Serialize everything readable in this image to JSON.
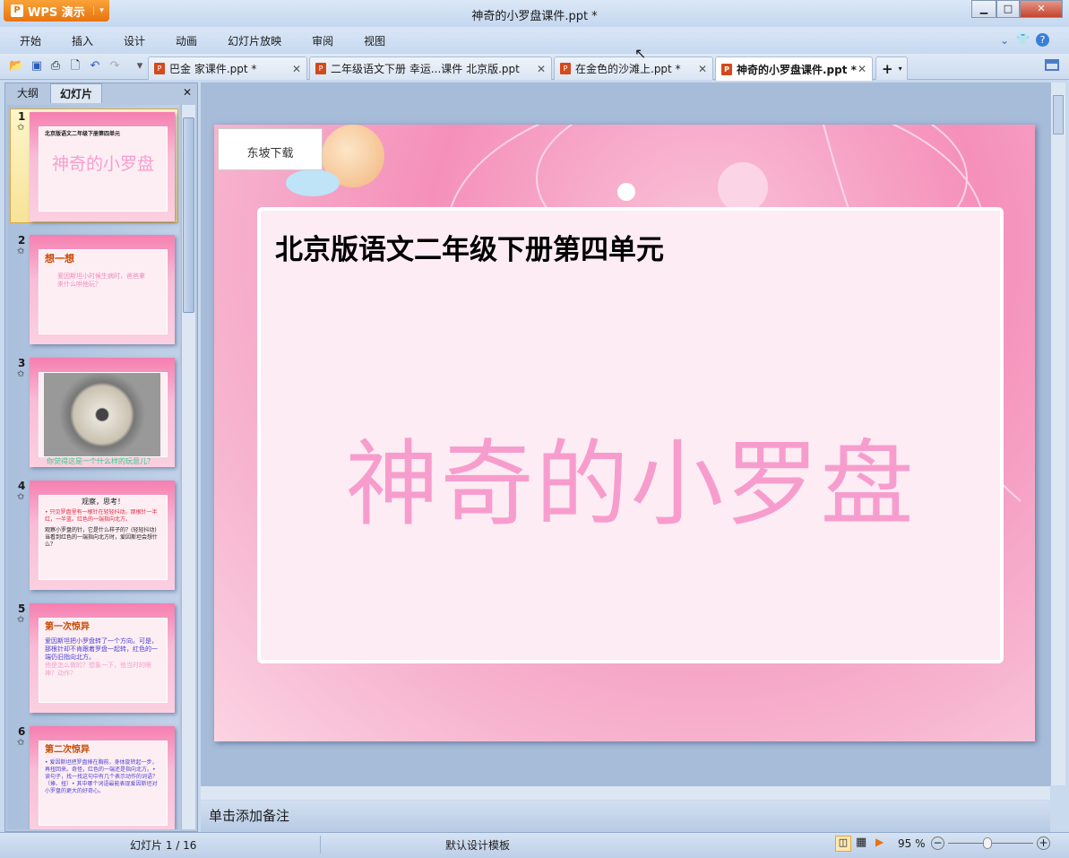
{
  "app": {
    "name": "WPS 演示",
    "window_title": "神奇的小罗盘课件.ppt *"
  },
  "menu": [
    "开始",
    "插入",
    "设计",
    "动画",
    "幻灯片放映",
    "审阅",
    "视图"
  ],
  "doc_tabs": [
    {
      "label": "巴金  家课件.ppt *",
      "active": false
    },
    {
      "label": "二年级语文下册 幸运...课件 北京版.ppt",
      "active": false
    },
    {
      "label": "在金色的沙滩上.ppt *",
      "active": false
    },
    {
      "label": "神奇的小罗盘课件.ppt *",
      "active": true
    }
  ],
  "panel": {
    "tabs": [
      "大纲",
      "幻灯片"
    ],
    "active_tab": "幻灯片"
  },
  "thumbnails": [
    {
      "num": "1",
      "header": "北京版语文二年级下册第四单元",
      "title": "神奇的小罗盘"
    },
    {
      "num": "2",
      "heading": "想一想",
      "text": "爱因斯坦小时候生病时，爸爸拿来什么哄他玩？"
    },
    {
      "num": "3",
      "caption": "你觉得这是一个什么样的玩意儿？"
    },
    {
      "num": "4",
      "heading": "观察，思考！",
      "red": "• 只见罗盘里有一根针在轻轻抖动。那根针一半红，一半蓝。红色的一端指向北方。",
      "text": "观察小罗盘的针，它是什么样子的？(轻轻抖动)当看到红色的一端指向北方时，爱因斯坦会想什么？"
    },
    {
      "num": "5",
      "heading": "第一次惊异",
      "text": "爱因斯坦把小罗盘转了一个方向。可是，那根针却不肯跟着罗盘一起转，红色的一端仍旧指向北方。",
      "pink": "他是怎么做的？想象一下，他当时的眼神？动作？"
    },
    {
      "num": "6",
      "heading": "第二次惊异",
      "text": "• 爱因斯坦把罗盘捧在胸前，身体旋转起一步，再扭回来。奇怪，红色的一端还是指向北方。• 读句子，找一找这句中有几个表示动作的词语？（捧、扭）• 其中哪个词语最能表现爱因斯坦对小罗盘的更大的好奇心。"
    }
  ],
  "slide": {
    "label_box": "东坡下载",
    "header": "北京版语文二年级下册第四单元",
    "title": "神奇的小罗盘"
  },
  "notes_placeholder": "单击添加备注",
  "status": {
    "slide_indicator": "幻灯片 1 / 16",
    "template": "默认设计模板",
    "zoom": "95 %",
    "zoom_percent": 95
  },
  "colors": {
    "accent": "#e8730f",
    "title_pink": "#f79dce"
  }
}
